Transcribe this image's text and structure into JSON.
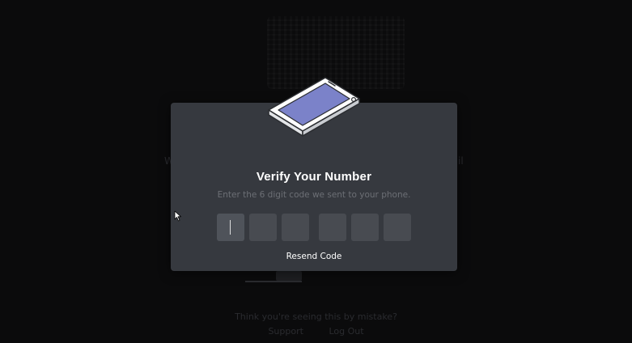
{
  "background": {
    "left_text": "W",
    "right_text": "il",
    "footer_question": "Think you're seeing this by mistake?",
    "footer_links": [
      "Support",
      "Log Out"
    ]
  },
  "modal": {
    "title": "Verify Your Number",
    "subtitle": "Enter the 6 digit code we sent to your phone.",
    "code_values": [
      "",
      "",
      "",
      "",
      "",
      ""
    ],
    "resend_label": "Resend Code"
  },
  "icons": {
    "illustration": "phone-icon",
    "pointer": "mouse-cursor-icon"
  },
  "colors": {
    "overlay_bg": "#0b0b0c",
    "modal_bg": "#36393f",
    "input_bg": "#484b51",
    "phone_screen": "#7b82c9",
    "text_primary": "#ffffff",
    "text_muted": "#6c6f75"
  }
}
